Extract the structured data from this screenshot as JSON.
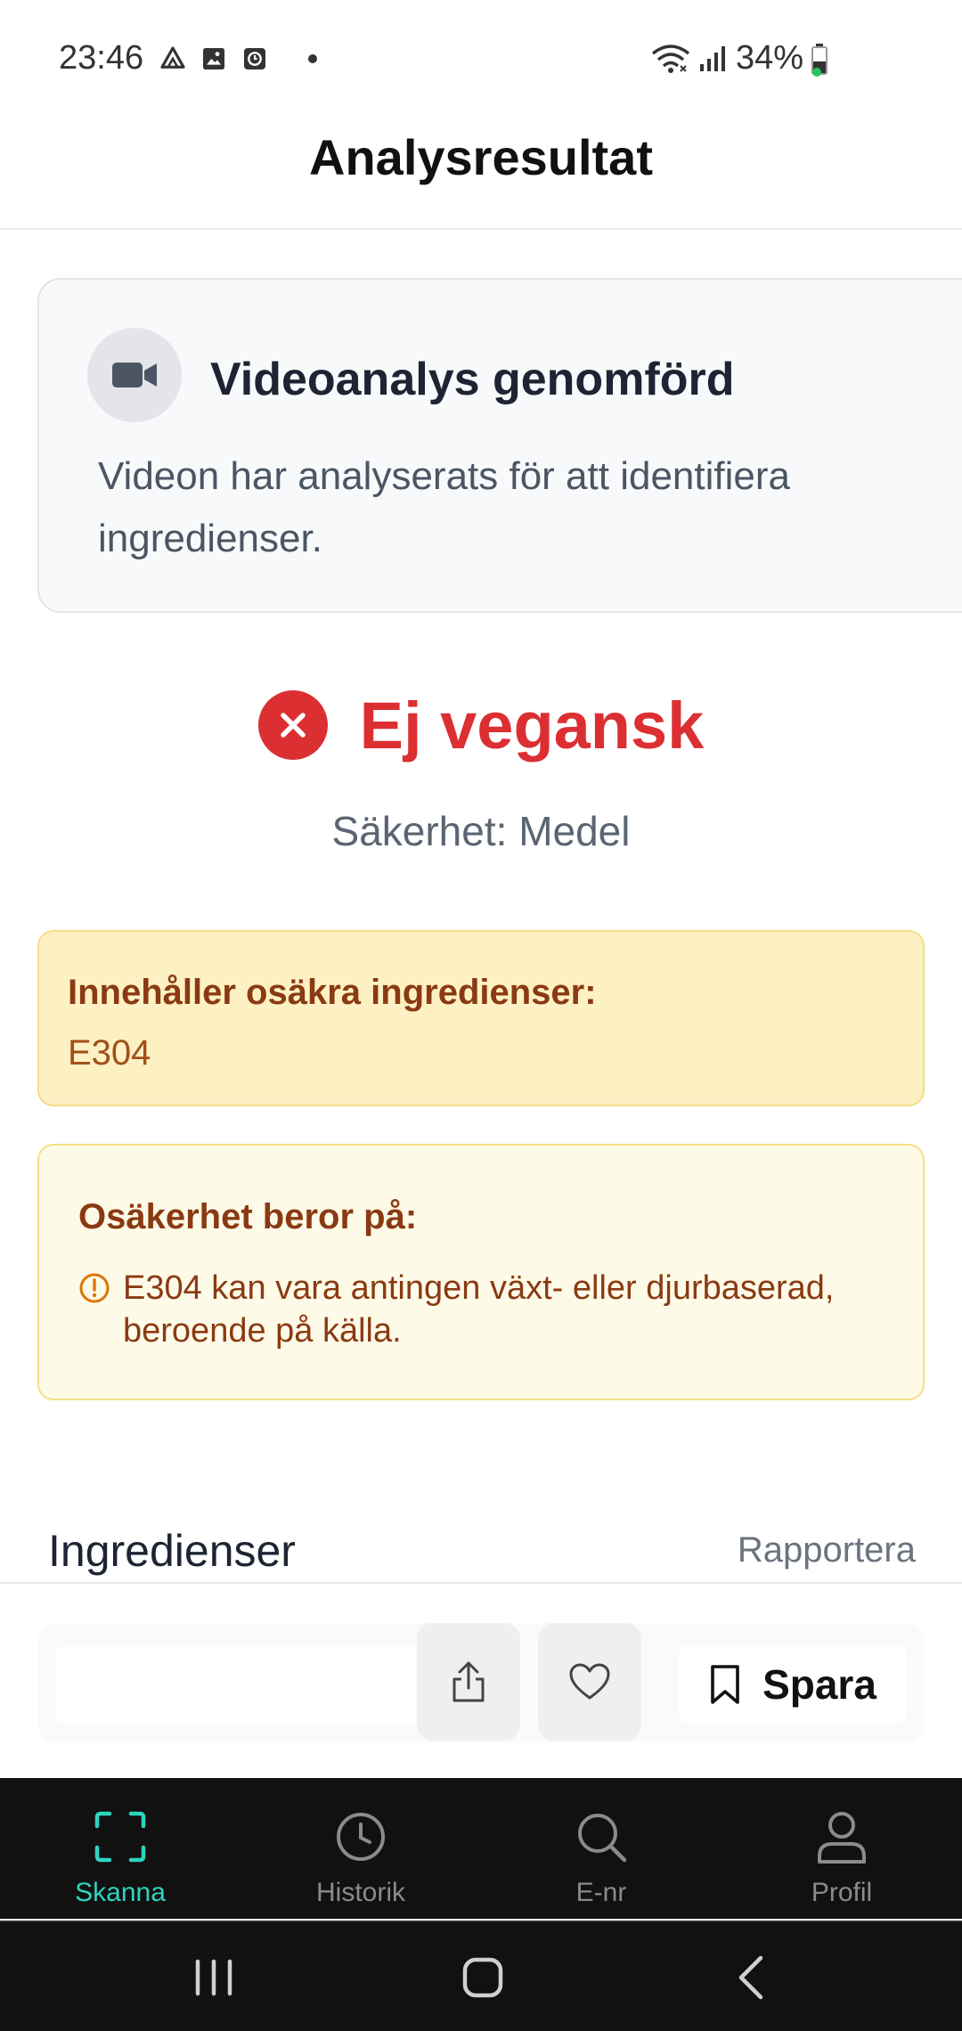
{
  "status_bar": {
    "time": "23:46",
    "battery": "34%",
    "left_icons": [
      "drive-icon",
      "image-icon",
      "clock-app-icon"
    ],
    "right_icons": [
      "wifi-icon",
      "signal-icon",
      "battery-icon"
    ]
  },
  "header": {
    "title": "Analysresultat"
  },
  "video_card": {
    "icon": "video-camera-icon",
    "title": "Videoanalys genomförd",
    "description": "Videon har analyserats för att identifiera ingredienser."
  },
  "verdict": {
    "icon": "close-circle-icon",
    "text": "Ej vegansk",
    "color": "#dc2f32",
    "confidence": "Säkerhet: Medel"
  },
  "unsafe": {
    "title": "Innehåller osäkra ingredienser:",
    "value": "E304"
  },
  "reason": {
    "title": "Osäkerhet beror på:",
    "items": [
      "E304 kan vara antingen växt- eller djurbaserad, beroende på källa."
    ]
  },
  "ingredients": {
    "title": "Ingredienser",
    "report_label": "Rapportera"
  },
  "actions": {
    "share_icon": "share-icon",
    "favorite_icon": "heart-icon",
    "save_icon": "bookmark-icon",
    "save_label": "Spara"
  },
  "bottom_nav": {
    "accent": "#2dd4bf",
    "items": [
      {
        "label": "Skanna",
        "icon": "scan-icon",
        "active": true
      },
      {
        "label": "Historik",
        "icon": "history-icon",
        "active": false
      },
      {
        "label": "E-nr",
        "icon": "search-icon",
        "active": false
      },
      {
        "label": "Profil",
        "icon": "profile-icon",
        "active": false
      }
    ]
  }
}
